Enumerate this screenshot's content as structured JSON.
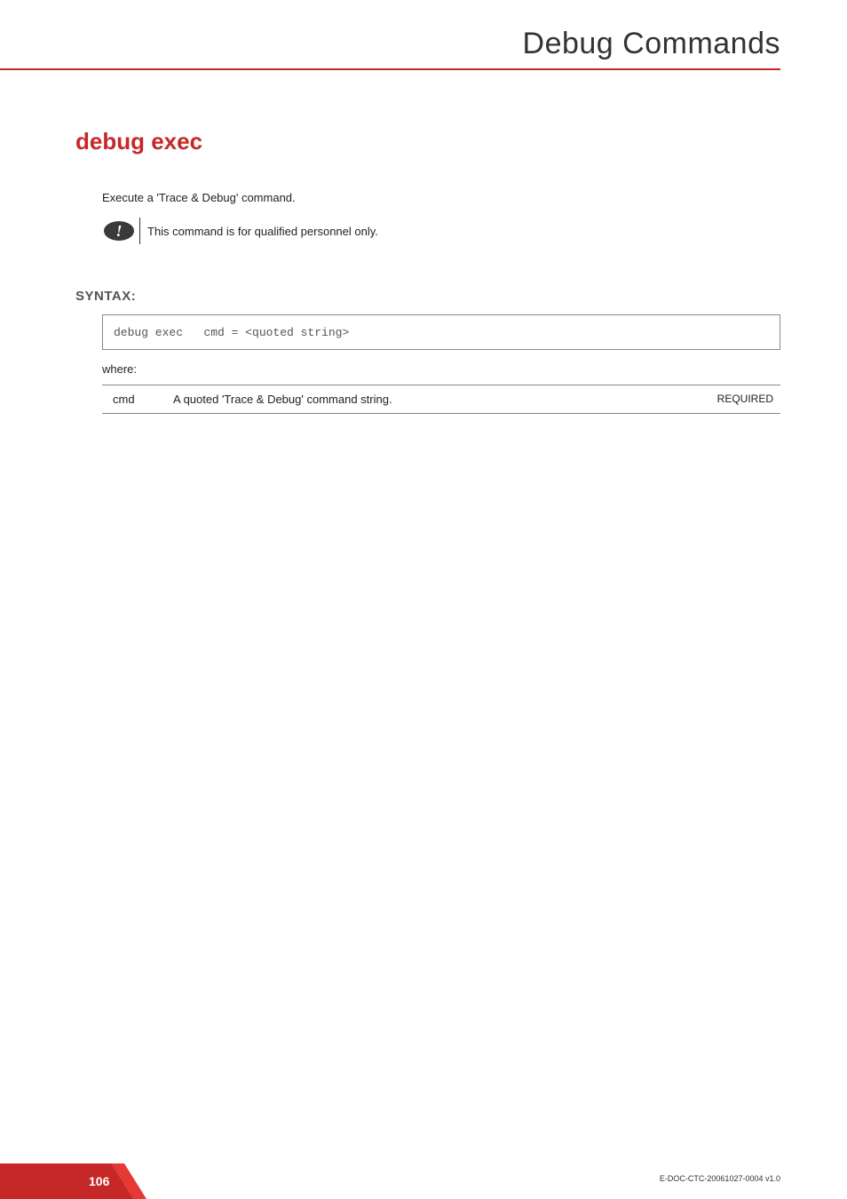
{
  "header": {
    "chapter_title": "Debug Commands"
  },
  "section": {
    "title": "debug exec",
    "intro": "Execute a 'Trace & Debug' command.",
    "note": "This command is for qualified personnel only."
  },
  "syntax": {
    "heading": "SYNTAX:",
    "code": "debug exec   cmd = <quoted string>",
    "where_label": "where:",
    "params": [
      {
        "name": "cmd",
        "description": "A quoted 'Trace & Debug' command string.",
        "requirement": "REQUIRED"
      }
    ]
  },
  "footer": {
    "page_number": "106",
    "doc_ref": "E-DOC-CTC-20061027-0004 v1.0"
  }
}
